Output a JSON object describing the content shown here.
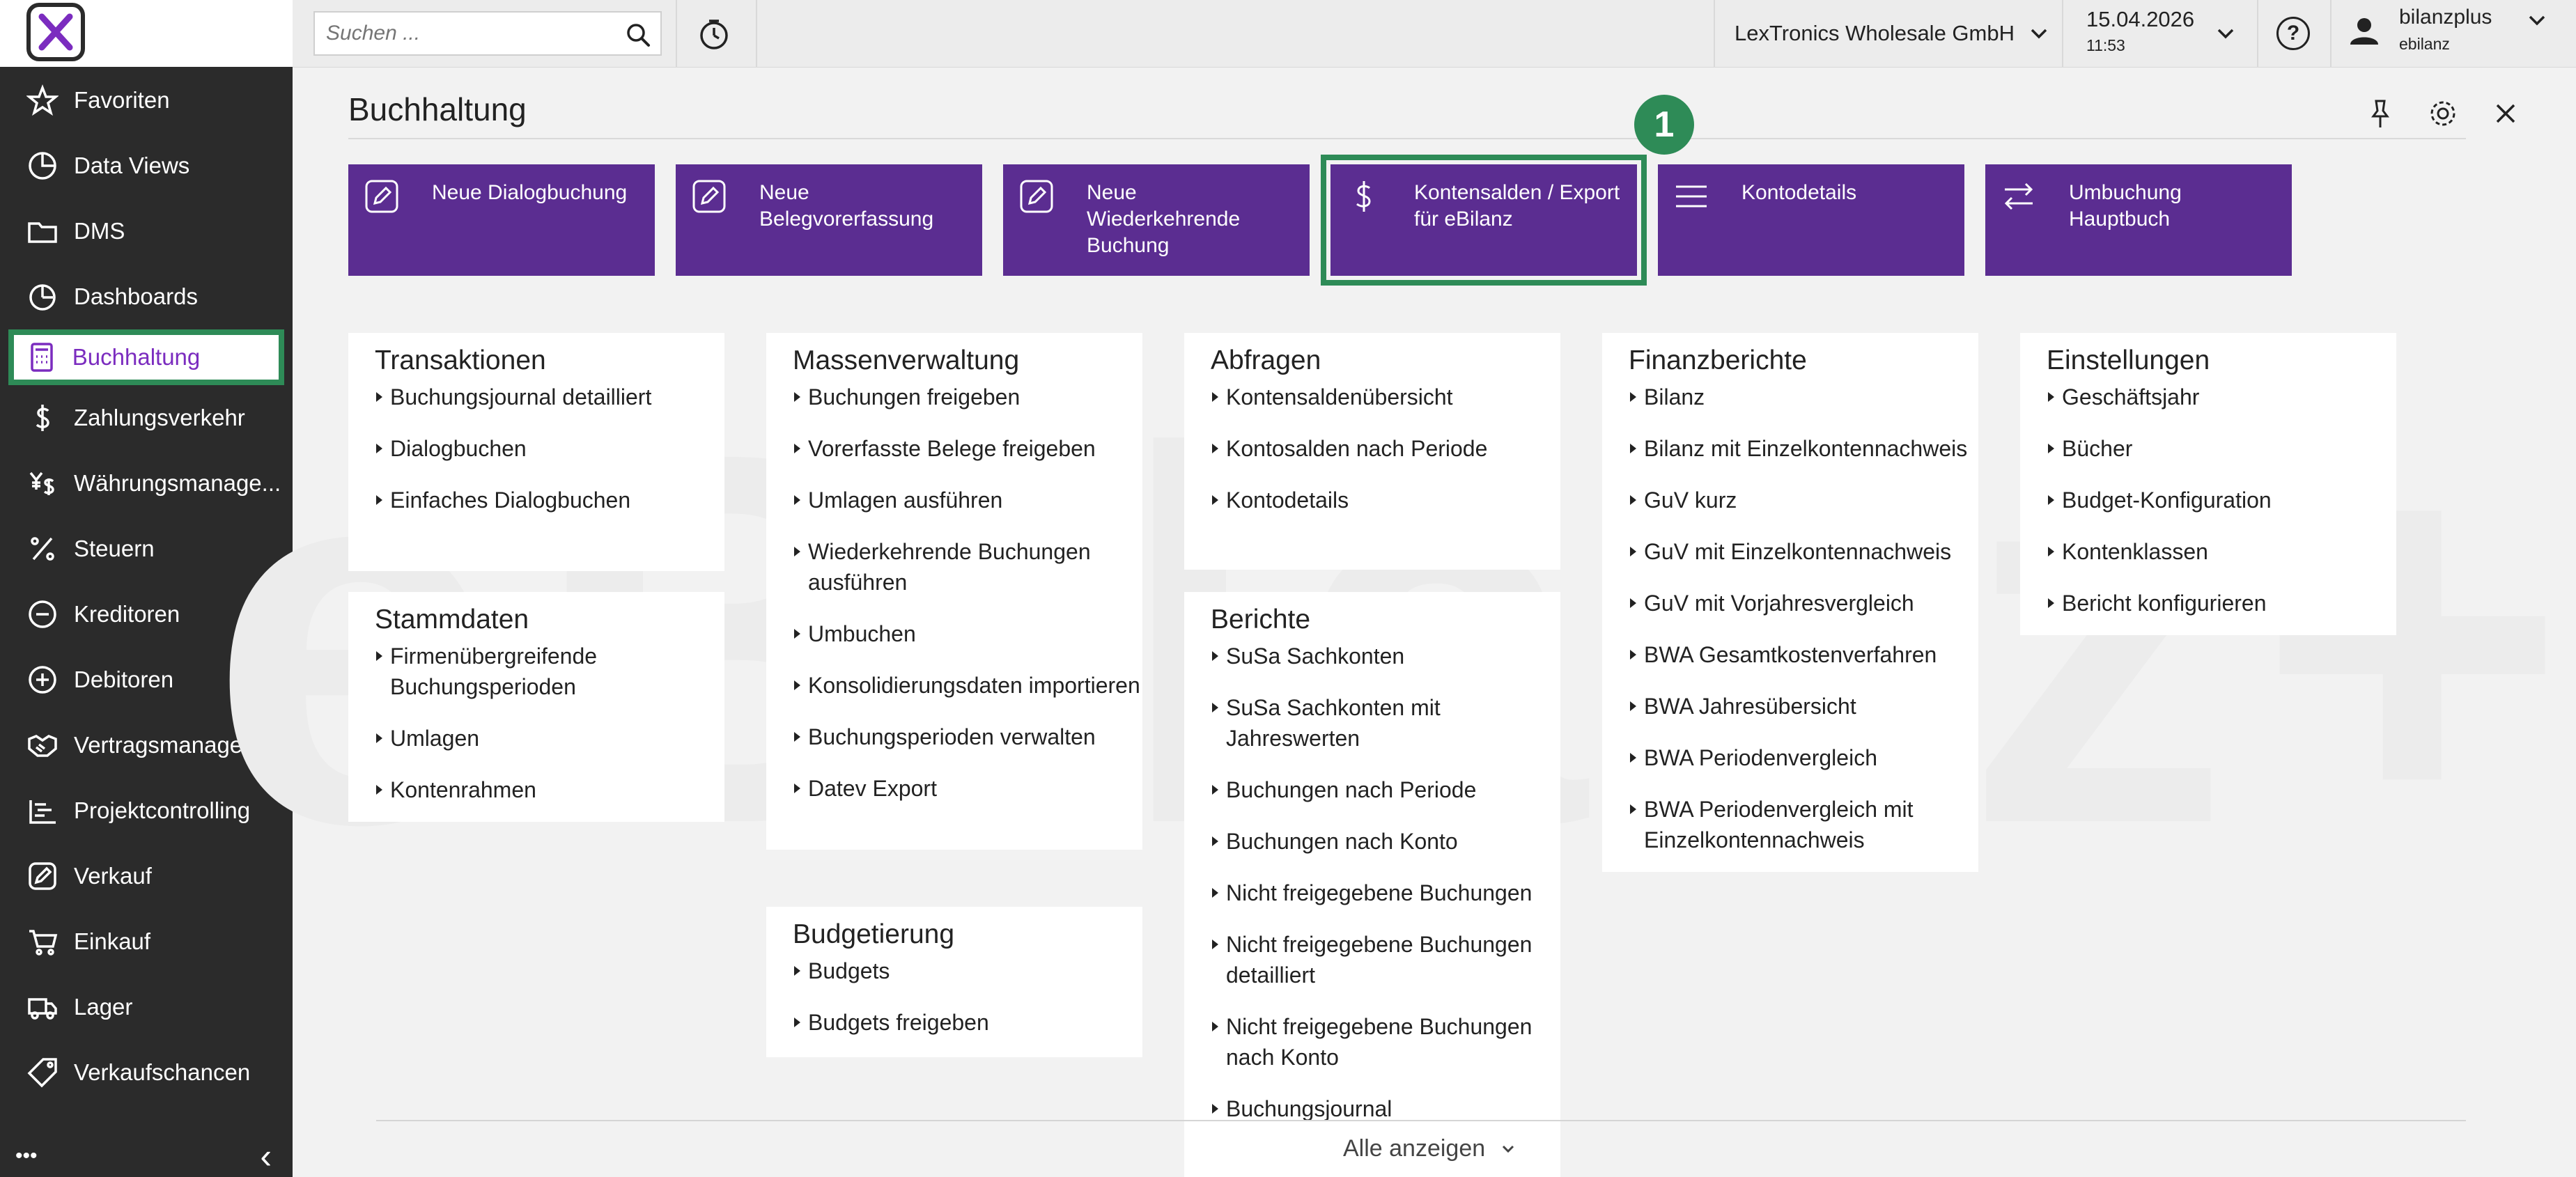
{
  "search": {
    "placeholder": "Suchen ..."
  },
  "topbar": {
    "company": "LexTronics Wholesale GmbH",
    "date": "15.04.2026",
    "time": "11:53",
    "user_name": "bilanzplus",
    "user_sub": "ebilanz"
  },
  "sidebar": {
    "items": [
      {
        "label": "Favoriten",
        "icon": "star-icon"
      },
      {
        "label": "Data Views",
        "icon": "pie-chart-icon"
      },
      {
        "label": "DMS",
        "icon": "folder-icon"
      },
      {
        "label": "Dashboards",
        "icon": "dashboard-icon"
      },
      {
        "label": "Buchhaltung",
        "icon": "calculator-icon",
        "active": true
      },
      {
        "label": "Zahlungsverkehr",
        "icon": "dollar-icon"
      },
      {
        "label": "Währungsmanage...",
        "icon": "currency-icon"
      },
      {
        "label": "Steuern",
        "icon": "percent-icon"
      },
      {
        "label": "Kreditoren",
        "icon": "minus-circle-icon"
      },
      {
        "label": "Debitoren",
        "icon": "plus-circle-icon"
      },
      {
        "label": "Vertragsmanagem...",
        "icon": "handshake-icon"
      },
      {
        "label": "Projektcontrolling",
        "icon": "gantt-icon"
      },
      {
        "label": "Verkauf",
        "icon": "edit-icon"
      },
      {
        "label": "Einkauf",
        "icon": "cart-icon"
      },
      {
        "label": "Lager",
        "icon": "truck-icon"
      },
      {
        "label": "Verkaufschancen",
        "icon": "tag-icon"
      }
    ],
    "more": "•••",
    "collapse": "‹"
  },
  "page": {
    "title": "Buchhaltung",
    "badge": "1",
    "show_all": "Alle anzeigen"
  },
  "tiles": [
    {
      "label": "Neue Dialogbuchung",
      "icon": "edit-icon"
    },
    {
      "label": "Neue Belegvorerfassung",
      "icon": "edit-icon"
    },
    {
      "label": "Neue Wiederkehrende Buchung",
      "icon": "edit-icon"
    },
    {
      "label": "Kontensalden / Export für eBilanz",
      "icon": "dollar-icon"
    },
    {
      "label": "Kontodetails",
      "icon": "menu-icon"
    },
    {
      "label": "Umbuchung Hauptbuch",
      "icon": "swap-icon"
    }
  ],
  "cards": {
    "transaktionen": {
      "title": "Transaktionen",
      "items": [
        "Buchungsjournal detailliert",
        "Dialogbuchen",
        "Einfaches Dialogbuchen"
      ]
    },
    "stammdaten": {
      "title": "Stammdaten",
      "items": [
        "Firmenübergreifende Buchungsperioden",
        "Umlagen",
        "Kontenrahmen"
      ]
    },
    "massenverwaltung": {
      "title": "Massenverwaltung",
      "items": [
        "Buchungen freigeben",
        "Vorerfasste Belege freigeben",
        "Umlagen ausführen",
        "Wiederkehrende Buchungen ausführen",
        "Umbuchen",
        "Konsolidierungsdaten importieren",
        "Buchungsperioden verwalten",
        "Datev Export"
      ]
    },
    "budgetierung": {
      "title": "Budgetierung",
      "items": [
        "Budgets",
        "Budgets freigeben"
      ]
    },
    "abfragen": {
      "title": "Abfragen",
      "items": [
        "Kontensaldenübersicht",
        "Kontosalden nach Periode",
        "Kontodetails"
      ]
    },
    "berichte": {
      "title": "Berichte",
      "items": [
        "SuSa Sachkonten",
        "SuSa Sachkonten mit Jahreswerten",
        "Buchungen nach Periode",
        "Buchungen nach Konto",
        "Nicht freigegebene Buchungen",
        "Nicht freigegebene Buchungen detailliert",
        "Nicht freigegebene Buchungen nach Konto",
        "Buchungsjournal"
      ]
    },
    "finanzberichte": {
      "title": "Finanzberichte",
      "items": [
        "Bilanz",
        "Bilanz mit Einzelkontennachweis",
        "GuV kurz",
        "GuV mit Einzelkontennachweis",
        "GuV mit Vorjahresvergleich",
        "BWA Gesamtkostenverfahren",
        "BWA Jahresübersicht",
        "BWA Periodenvergleich",
        "BWA Periodenvergleich mit Einzelkontennachweis"
      ]
    },
    "einstellungen": {
      "title": "Einstellungen",
      "items": [
        "Geschäftsjahr",
        "Bücher",
        "Budget-Konfiguration",
        "Kontenklassen",
        "Bericht konfigurieren"
      ]
    }
  },
  "colors": {
    "accent": "#5b2d91",
    "highlight": "#2e8b57",
    "sidebar": "#2b2b2b",
    "active_text": "#7b2cbf"
  }
}
